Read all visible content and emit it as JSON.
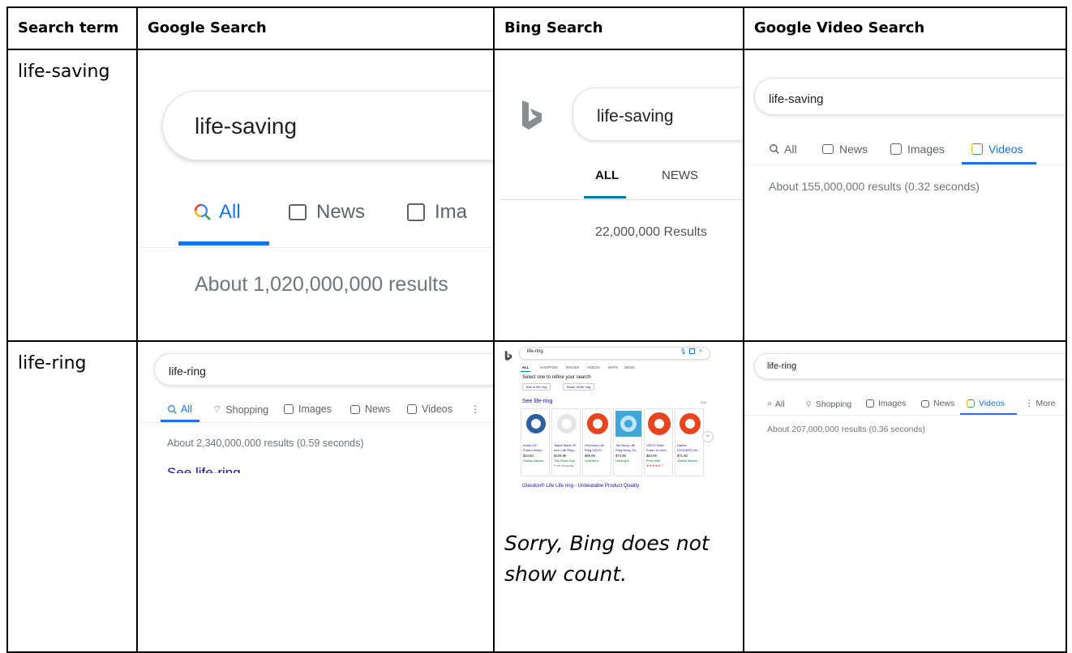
{
  "headers": [
    "Search term",
    "Google Search",
    "Bing Search",
    "Google Video Search"
  ],
  "rows": [
    {
      "term": "life-saving",
      "google": {
        "query": "life-saving",
        "tabs": [
          "All",
          "News",
          "Ima"
        ],
        "count": "About 1,020,000,000 results"
      },
      "bing": {
        "query": "life-saving",
        "tabs": [
          "ALL",
          "NEWS"
        ],
        "count": "22,000,000 Results"
      },
      "google_video": {
        "query": "life-saving",
        "tabs": [
          "All",
          "News",
          "Images",
          "Videos"
        ],
        "count": "About 155,000,000 results (0.32 seconds)"
      }
    },
    {
      "term": "life-ring",
      "google": {
        "query": "life-ring",
        "tabs": [
          "All",
          "Shopping",
          "Images",
          "News",
          "Videos"
        ],
        "count": "About 2,340,000,000 results (0.59 seconds)",
        "cut_link": "See life-ring"
      },
      "bing": {
        "query": "life-ring",
        "tabs": [
          "ALL",
          "SHOPPING",
          "IMAGES",
          "VIDEOS",
          "MAPS",
          "NEWS"
        ],
        "refine": "Select one to refine your search",
        "chips": [
          "tree of life ring",
          "flower of life ring"
        ],
        "shop_title": "See life-ring",
        "ads": "Ads",
        "products": [
          {
            "name1": "Kemp 24\"",
            "name2": "Foam Lifesyl...",
            "price": "$34.50",
            "seller": "Global Industr..."
          },
          {
            "name1": "Taylor Made 20",
            "name2": "Inch Life Ring...",
            "price": "$109.99",
            "seller": "The Pond Guy",
            "extra": "Free shipping"
          },
          {
            "name1": "Overtons Life",
            "name2": "Ring USCG...",
            "price": "$69.99",
            "seller": "Overton's"
          },
          {
            "name1": "Jim Buoy Life",
            "name2": "Ring Buoy, 20...",
            "price": "$74.69",
            "seller": "Doheny's"
          },
          {
            "name1": "USCG Solid",
            "name2": "Foam 24 Inch...",
            "price": "$84.09",
            "seller": "Pool Web",
            "extra": "★★★★★ 7"
          },
          {
            "name1": "Datrex",
            "name2": "DX024RD Life...",
            "price": "$71.95",
            "seller": "Global Industr..."
          }
        ],
        "ad_title": "Glasdon® Life Life ring - Unbeatable Product Quality",
        "note": "Sorry, Bing does not show count."
      },
      "google_video": {
        "query": "life-ring",
        "tabs": [
          "All",
          "Shopping",
          "Images",
          "News",
          "Videos",
          "More"
        ],
        "count": "About 207,000,000 results (0.36 seconds)"
      }
    }
  ],
  "colors": {
    "google_blue": "#1a73e8",
    "bing_green": "#006d21",
    "bing_link": "#1a0dab",
    "ring_orange": "#e8451e",
    "ring_blue": "#3ea6d8"
  },
  "icons": [
    "search-icon",
    "news-icon",
    "images-icon",
    "videos-icon",
    "tag-icon",
    "more-icon",
    "bing-logo",
    "mic-icon",
    "visual-search-icon"
  ]
}
